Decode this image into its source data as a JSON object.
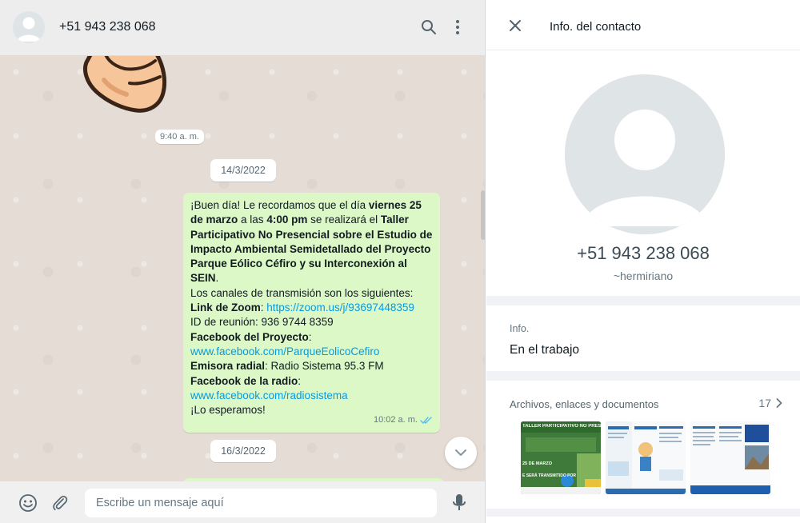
{
  "chat": {
    "contact_name": "+51 943 238 068",
    "search_icon": "search-icon",
    "menu_icon": "more-vertical-icon",
    "sticker_time": "9:40 a. m.",
    "date_1": "14/3/2022",
    "date_2": "16/3/2022",
    "message": {
      "p1_a": "¡Buen día! Le recordamos que el día ",
      "p1_b": "viernes 25 de marzo",
      "p1_c": " a las ",
      "p1_d": "4:00 pm",
      "p1_e": " se realizará el ",
      "p1_f": "Taller Participativo No Presencial sobre el Estudio de Impacto Ambiental Semidetallado del Proyecto Parque Eólico Céfiro y su Interconexión al SEIN",
      "p1_g": ".",
      "line_channels": "Los canales de transmisión son los siguientes:",
      "zoom_label": "Link de Zoom",
      "zoom_link": "https://zoom.us/j/93697448359",
      "meeting_id": "ID de reunión: 936 9744 8359",
      "fb_project_label": "Facebook del Proyecto",
      "fb_project_link": "www.facebook.com/ParqueEolicoCefiro",
      "radio_label": "Emisora radial",
      "radio_value": ": Radio Sistema 95.3 FM",
      "fb_radio_label": "Facebook de la radio",
      "fb_radio_link": "www.facebook.com/radiosistema",
      "closing": "¡Lo esperamos!",
      "time": "10:02 a. m."
    },
    "composer": {
      "placeholder": "Escribe un mensaje aquí",
      "emoji_icon": "emoji-icon",
      "attach_icon": "paperclip-icon",
      "mic_icon": "microphone-icon"
    }
  },
  "info": {
    "title": "Info. del contacto",
    "phone": "+51 943 238 068",
    "nickname": "~hermiriano",
    "about_label": "Info.",
    "about_text": "En el trabajo",
    "media_label": "Archivos, enlaces y documentos",
    "media_count": "17",
    "thumbnails": [
      {
        "text_1": "TALLER PARTICIPATIVO NO PRESENCI",
        "text_2": "25 DE MARZO",
        "text_3": "E SERÁ TRANSMITIDO POR"
      },
      {
        "text_1": ""
      },
      {
        "text_1": ""
      }
    ]
  },
  "colors": {
    "chat_bg": "#e5ddd5",
    "bubble_out": "#dcf8c6",
    "link": "#039be5",
    "read_ticks": "#53bdeb",
    "header_bg": "#ededed"
  }
}
